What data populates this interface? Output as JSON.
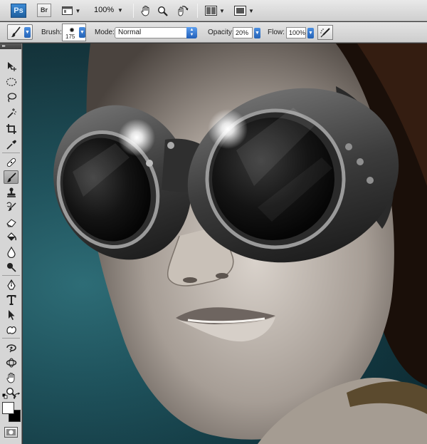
{
  "app": {
    "logo_label": "Ps",
    "bridge_label": "Br",
    "zoom_label": "100%",
    "icons": [
      "ps-logo",
      "bridge-icon",
      "screen-mode-icon",
      "hand-icon",
      "zoom-icon",
      "rotate-view-icon",
      "arrange-documents-icon",
      "screen-frame-icon"
    ]
  },
  "options": {
    "brush_label": "Brush:",
    "brush_size": "175",
    "mode_label": "Mode:",
    "mode_value": "Normal",
    "opacity_label": "Opacity:",
    "opacity_value": "20%",
    "flow_label": "Flow:",
    "flow_value": "100%"
  },
  "tools": {
    "header": "▸▸",
    "items": [
      "move-tool",
      "marquee-tool",
      "lasso-tool",
      "quick-selection-tool",
      "crop-tool",
      "eyedropper-tool",
      "healing-brush-tool",
      "brush-tool",
      "clone-stamp-tool",
      "history-brush-tool",
      "eraser-tool",
      "paint-bucket-tool",
      "blur-tool",
      "dodge-tool",
      "pen-tool",
      "type-tool",
      "path-selection-tool",
      "shape-tool",
      "3d-rotate-tool",
      "3d-orbit-tool",
      "hand-tool",
      "zoom-tool"
    ],
    "active": "brush-tool",
    "foreground_color": "#ffffff",
    "background_color": "#000000"
  },
  "colors": {
    "canvas_background": "#1d5c69",
    "accent": "#2463b6"
  }
}
